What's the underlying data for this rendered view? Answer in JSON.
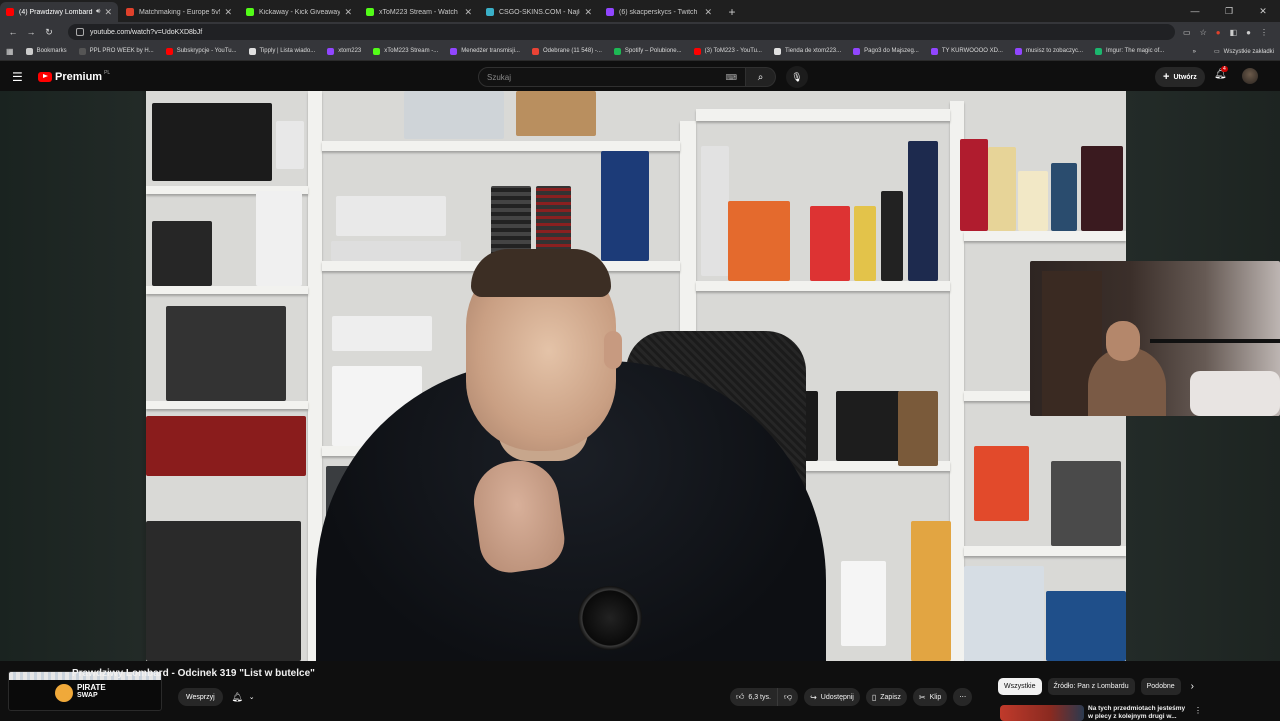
{
  "browser": {
    "tabs": [
      {
        "title": "(4) Prawdziwy Lombard - O",
        "active": true,
        "color": "#ff0000",
        "audio": true
      },
      {
        "title": "Matchmaking - Europe 5v5 Qu",
        "active": false,
        "color": "#e0412b"
      },
      {
        "title": "Kickaway - Kick Giveaway Tool",
        "active": false,
        "color": "#53fc18"
      },
      {
        "title": "xToM223 Stream - Watch Live o",
        "active": false,
        "color": "#53fc18"
      },
      {
        "title": "CSGO-SKINS.COM - Najlepsz",
        "active": false,
        "color": "#3ab0c8"
      },
      {
        "title": "(6) skacperskycs - Twitch",
        "active": false,
        "color": "#9146ff"
      }
    ],
    "url": "youtube.com/watch?v=UdoKXD8bJf",
    "bookmarks": [
      {
        "label": "Bookmarks",
        "color": "#cccccc"
      },
      {
        "label": "PPL PRO WEEK by H...",
        "color": "#555555"
      },
      {
        "label": "Subskrypcje - YouTu...",
        "color": "#ff0000"
      },
      {
        "label": "Tipply | Lista wiado...",
        "color": "#e0e0e0"
      },
      {
        "label": "xtom223",
        "color": "#9146ff"
      },
      {
        "label": "xToM223 Stream -...",
        "color": "#53fc18"
      },
      {
        "label": "Menedżer transmisji...",
        "color": "#9146ff"
      },
      {
        "label": "Odebrane (11 548) -...",
        "color": "#ea4335"
      },
      {
        "label": "Spotify – Polubione...",
        "color": "#1db954"
      },
      {
        "label": "(3) ToM223 - YouTu...",
        "color": "#ff0000"
      },
      {
        "label": "Tienda de xtom223...",
        "color": "#e0e0e0"
      },
      {
        "label": "Pago3 do Majszeg...",
        "color": "#9146ff"
      },
      {
        "label": "TY KURWOOOO XD...",
        "color": "#9146ff"
      },
      {
        "label": "musisz to zobaczyc...",
        "color": "#9146ff"
      },
      {
        "label": "Imgur: The magic of...",
        "color": "#1bb76e"
      }
    ],
    "bookmarks_more": "Wszystkie zakładki"
  },
  "youtube": {
    "brand": "Premium",
    "brand_region": "PL",
    "search_placeholder": "Szukaj",
    "create_label": "Utwórz",
    "notifications_count": "4",
    "video_title": "Prawdziwy Lombard - Odcinek 319 \"List w butelce\"",
    "promo": {
      "line1": "PIRATE",
      "line2": "SWAP"
    },
    "support_label": "Wesprzyj",
    "likes": "6,3 tys.",
    "share_label": "Udostępnij",
    "save_label": "Zapisz",
    "clip_label": "Klip",
    "chips": [
      "Wszystkie",
      "Źródło: Pan z Lombardu",
      "Podobne"
    ],
    "recommendation_title": "Na tych przedmiotach jesteśmy w plecy z kolejnym drugi w..."
  }
}
